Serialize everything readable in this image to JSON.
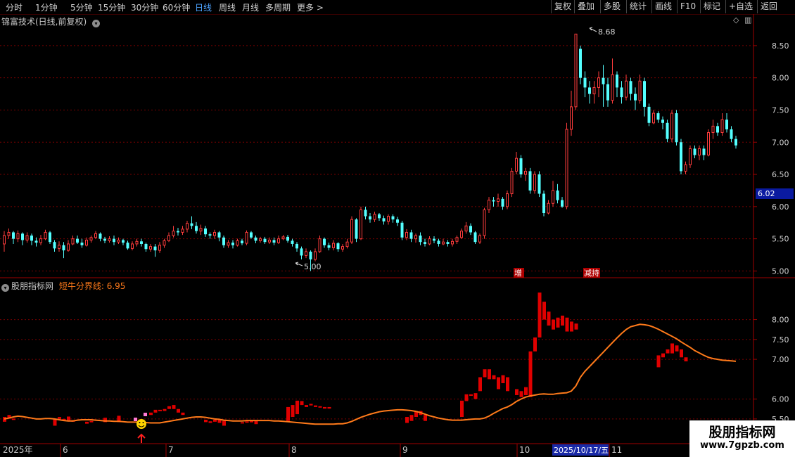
{
  "toolbar": {
    "periods": [
      "分时",
      "1分钟",
      "5分钟",
      "15分钟",
      "30分钟",
      "60分钟",
      "日线",
      "周线",
      "月线",
      "多周期",
      "更多 >"
    ],
    "active_period": "日线",
    "tools": [
      "复权",
      "叠加",
      "多股",
      "统计",
      "画线",
      "F10",
      "标记",
      "+自选",
      "返回"
    ]
  },
  "price_panel": {
    "title": "锦富技术(日线,前复权)",
    "y_ticks": [
      "8.50",
      "8.00",
      "7.50",
      "7.00",
      "6.50",
      "6.00",
      "5.50",
      "5.00"
    ],
    "current_price_label": "6.02",
    "high_label": "8.68",
    "low_label": "5.00",
    "event_markers": [
      "增",
      "减持"
    ]
  },
  "indicator_panel": {
    "title": "股朋指标网",
    "line_label": "短牛分界线: 6.95",
    "y_ticks": [
      "8.00",
      "7.50",
      "7.00",
      "6.00",
      "5.50"
    ]
  },
  "time_axis": {
    "labels": [
      "2025年",
      "6",
      "7",
      "8",
      "9",
      "10",
      "11"
    ],
    "cursor_date": "2025/10/17/五"
  },
  "watermark": {
    "line1": "股朋指标网",
    "line2": "www.7gpzb.com"
  },
  "colors": {
    "up": "#ff3c3c",
    "down": "#54ffff",
    "indicator_bar": "#e00000",
    "line": "#ff7a1a",
    "grid": "#7a0000",
    "active_period": "#4da3ff"
  },
  "chart_data": {
    "type": "candlestick",
    "y_range": [
      4.95,
      8.75
    ],
    "indicator_y_range": [
      5.25,
      8.7
    ],
    "candles": [
      [
        5.42,
        5.55,
        5.62,
        5.3
      ],
      [
        5.55,
        5.6,
        5.66,
        5.5
      ],
      [
        5.6,
        5.5,
        5.62,
        5.42
      ],
      [
        5.5,
        5.58,
        5.63,
        5.45
      ],
      [
        5.58,
        5.48,
        5.6,
        5.4
      ],
      [
        5.48,
        5.55,
        5.6,
        5.44
      ],
      [
        5.55,
        5.47,
        5.58,
        5.4
      ],
      [
        5.47,
        5.44,
        5.52,
        5.38
      ],
      [
        5.44,
        5.5,
        5.56,
        5.4
      ],
      [
        5.5,
        5.6,
        5.64,
        5.48
      ],
      [
        5.6,
        5.45,
        5.62,
        5.42
      ],
      [
        5.45,
        5.35,
        5.48,
        5.3
      ],
      [
        5.35,
        5.4,
        5.46,
        5.3
      ],
      [
        5.4,
        5.32,
        5.45,
        5.2
      ],
      [
        5.32,
        5.42,
        5.48,
        5.3
      ],
      [
        5.42,
        5.5,
        5.55,
        5.4
      ],
      [
        5.5,
        5.44,
        5.55,
        5.42
      ],
      [
        5.44,
        5.4,
        5.5,
        5.36
      ],
      [
        5.4,
        5.48,
        5.52,
        5.38
      ],
      [
        5.48,
        5.52,
        5.55,
        5.44
      ],
      [
        5.52,
        5.58,
        5.62,
        5.5
      ],
      [
        5.58,
        5.5,
        5.6,
        5.46
      ],
      [
        5.5,
        5.47,
        5.53,
        5.43
      ],
      [
        5.47,
        5.5,
        5.54,
        5.44
      ],
      [
        5.5,
        5.45,
        5.55,
        5.4
      ],
      [
        5.45,
        5.48,
        5.52,
        5.42
      ],
      [
        5.48,
        5.44,
        5.5,
        5.4
      ],
      [
        5.44,
        5.35,
        5.47,
        5.33
      ],
      [
        5.35,
        5.42,
        5.46,
        5.32
      ],
      [
        5.42,
        5.46,
        5.5,
        5.38
      ],
      [
        5.46,
        5.42,
        5.5,
        5.38
      ],
      [
        5.42,
        5.34,
        5.44,
        5.3
      ],
      [
        5.34,
        5.38,
        5.42,
        5.3
      ],
      [
        5.38,
        5.32,
        5.42,
        5.22
      ],
      [
        5.32,
        5.4,
        5.45,
        5.28
      ],
      [
        5.4,
        5.47,
        5.5,
        5.36
      ],
      [
        5.47,
        5.55,
        5.6,
        5.45
      ],
      [
        5.55,
        5.62,
        5.7,
        5.52
      ],
      [
        5.62,
        5.6,
        5.67,
        5.55
      ],
      [
        5.6,
        5.65,
        5.7,
        5.56
      ],
      [
        5.65,
        5.74,
        5.78,
        5.6
      ],
      [
        5.74,
        5.7,
        5.85,
        5.65
      ],
      [
        5.7,
        5.62,
        5.76,
        5.58
      ],
      [
        5.62,
        5.66,
        5.72,
        5.56
      ],
      [
        5.66,
        5.57,
        5.7,
        5.53
      ],
      [
        5.57,
        5.55,
        5.6,
        5.5
      ],
      [
        5.55,
        5.6,
        5.64,
        5.5
      ],
      [
        5.6,
        5.52,
        5.62,
        5.46
      ],
      [
        5.52,
        5.4,
        5.55,
        5.36
      ],
      [
        5.4,
        5.44,
        5.48,
        5.36
      ],
      [
        5.44,
        5.4,
        5.48,
        5.35
      ],
      [
        5.4,
        5.47,
        5.5,
        5.38
      ],
      [
        5.47,
        5.43,
        5.5,
        5.4
      ],
      [
        5.43,
        5.6,
        5.63,
        5.4
      ],
      [
        5.6,
        5.52,
        5.62,
        5.5
      ],
      [
        5.52,
        5.47,
        5.55,
        5.43
      ],
      [
        5.47,
        5.5,
        5.53,
        5.44
      ],
      [
        5.5,
        5.45,
        5.53,
        5.42
      ],
      [
        5.45,
        5.48,
        5.52,
        5.42
      ],
      [
        5.48,
        5.44,
        5.52,
        5.4
      ],
      [
        5.44,
        5.5,
        5.55,
        5.42
      ],
      [
        5.5,
        5.53,
        5.56,
        5.48
      ],
      [
        5.53,
        5.47,
        5.56,
        5.44
      ],
      [
        5.47,
        5.42,
        5.5,
        5.38
      ],
      [
        5.42,
        5.35,
        5.45,
        5.3
      ],
      [
        5.35,
        5.24,
        5.38,
        5.18
      ],
      [
        5.24,
        5.3,
        5.35,
        5.2
      ],
      [
        5.3,
        5.18,
        5.32,
        5.0
      ],
      [
        5.18,
        5.3,
        5.35,
        5.15
      ],
      [
        5.3,
        5.5,
        5.55,
        5.28
      ],
      [
        5.5,
        5.4,
        5.52,
        5.36
      ],
      [
        5.4,
        5.36,
        5.44,
        5.32
      ],
      [
        5.36,
        5.43,
        5.48,
        5.32
      ],
      [
        5.43,
        5.34,
        5.45,
        5.3
      ],
      [
        5.34,
        5.38,
        5.42,
        5.3
      ],
      [
        5.38,
        5.45,
        5.5,
        5.35
      ],
      [
        5.45,
        5.8,
        5.85,
        5.42
      ],
      [
        5.8,
        5.5,
        5.82,
        5.45
      ],
      [
        5.5,
        5.95,
        6.0,
        5.48
      ],
      [
        5.95,
        5.85,
        6.0,
        5.8
      ],
      [
        5.85,
        5.8,
        5.9,
        5.75
      ],
      [
        5.8,
        5.88,
        5.92,
        5.76
      ],
      [
        5.88,
        5.82,
        5.9,
        5.78
      ],
      [
        5.82,
        5.77,
        5.86,
        5.72
      ],
      [
        5.77,
        5.85,
        5.88,
        5.72
      ],
      [
        5.85,
        5.8,
        5.88,
        5.75
      ],
      [
        5.8,
        5.75,
        5.84,
        5.7
      ],
      [
        5.75,
        5.52,
        5.78,
        5.48
      ],
      [
        5.52,
        5.6,
        5.65,
        5.48
      ],
      [
        5.6,
        5.5,
        5.64,
        5.45
      ],
      [
        5.5,
        5.55,
        5.58,
        5.44
      ],
      [
        5.55,
        5.45,
        5.6,
        5.4
      ],
      [
        5.45,
        5.42,
        5.5,
        5.38
      ],
      [
        5.42,
        5.5,
        5.54,
        5.4
      ],
      [
        5.5,
        5.47,
        5.54,
        5.43
      ],
      [
        5.47,
        5.42,
        5.5,
        5.38
      ],
      [
        5.42,
        5.45,
        5.5,
        5.4
      ],
      [
        5.45,
        5.42,
        5.48,
        5.38
      ],
      [
        5.42,
        5.46,
        5.5,
        5.38
      ],
      [
        5.46,
        5.52,
        5.55,
        5.42
      ],
      [
        5.52,
        5.62,
        5.66,
        5.5
      ],
      [
        5.62,
        5.7,
        5.76,
        5.58
      ],
      [
        5.7,
        5.6,
        5.74,
        5.56
      ],
      [
        5.6,
        5.45,
        5.62,
        5.42
      ],
      [
        5.45,
        5.55,
        5.58,
        5.42
      ],
      [
        5.55,
        5.95,
        5.98,
        5.5
      ],
      [
        5.95,
        6.1,
        6.15,
        5.9
      ],
      [
        6.1,
        6.08,
        6.15,
        6.0
      ],
      [
        6.08,
        6.12,
        6.2,
        6.0
      ],
      [
        6.12,
        6.0,
        6.15,
        5.95
      ],
      [
        6.0,
        6.2,
        6.25,
        5.96
      ],
      [
        6.2,
        6.55,
        6.6,
        6.15
      ],
      [
        6.55,
        6.75,
        6.85,
        6.5
      ],
      [
        6.75,
        6.5,
        6.8,
        6.45
      ],
      [
        6.5,
        6.55,
        6.6,
        6.4
      ],
      [
        6.55,
        6.25,
        6.6,
        6.2
      ],
      [
        6.25,
        6.5,
        6.55,
        6.2
      ],
      [
        6.5,
        6.2,
        6.55,
        6.15
      ],
      [
        6.2,
        5.9,
        6.25,
        5.85
      ],
      [
        5.9,
        6.05,
        6.1,
        5.88
      ],
      [
        6.05,
        6.25,
        6.4,
        6.0
      ],
      [
        6.25,
        6.1,
        6.35,
        6.05
      ],
      [
        6.1,
        6.0,
        6.15,
        5.98
      ],
      [
        6.0,
        7.2,
        7.3,
        5.96
      ],
      [
        7.2,
        7.55,
        7.8,
        7.1
      ],
      [
        7.55,
        8.68,
        8.68,
        7.5
      ],
      [
        8.45,
        8.0,
        8.5,
        7.9
      ],
      [
        8.0,
        7.85,
        8.1,
        7.7
      ],
      [
        7.85,
        7.75,
        7.95,
        7.6
      ],
      [
        7.75,
        7.85,
        7.95,
        7.6
      ],
      [
        7.85,
        8.0,
        8.1,
        7.7
      ],
      [
        8.0,
        7.9,
        8.2,
        7.55
      ],
      [
        7.9,
        7.65,
        8.0,
        7.55
      ],
      [
        7.65,
        8.05,
        8.3,
        7.6
      ],
      [
        8.05,
        7.85,
        8.1,
        7.7
      ],
      [
        7.85,
        7.7,
        7.95,
        7.6
      ],
      [
        7.7,
        7.95,
        8.05,
        7.65
      ],
      [
        7.95,
        7.75,
        8.0,
        7.65
      ],
      [
        7.75,
        7.65,
        7.85,
        7.5
      ],
      [
        7.65,
        7.95,
        8.05,
        7.6
      ],
      [
        7.95,
        7.55,
        8.0,
        7.4
      ],
      [
        7.55,
        7.3,
        7.6,
        7.25
      ],
      [
        7.3,
        7.45,
        7.5,
        7.28
      ],
      [
        7.45,
        7.35,
        7.48,
        7.3
      ],
      [
        7.35,
        7.3,
        7.4,
        7.2
      ],
      [
        7.3,
        7.05,
        7.35,
        7.0
      ],
      [
        7.05,
        7.45,
        7.5,
        7.0
      ],
      [
        7.45,
        7.0,
        7.5,
        6.95
      ],
      [
        7.0,
        6.55,
        7.05,
        6.5
      ],
      [
        6.55,
        6.65,
        6.7,
        6.5
      ],
      [
        6.65,
        6.9,
        6.95,
        6.6
      ],
      [
        6.9,
        6.8,
        6.95,
        6.75
      ],
      [
        6.8,
        6.9,
        6.95,
        6.72
      ],
      [
        6.9,
        6.8,
        6.95,
        6.72
      ],
      [
        6.8,
        7.15,
        7.2,
        6.78
      ],
      [
        7.15,
        7.25,
        7.35,
        7.05
      ],
      [
        7.25,
        7.15,
        7.3,
        7.1
      ],
      [
        7.15,
        7.35,
        7.45,
        7.1
      ],
      [
        7.35,
        7.2,
        7.45,
        7.15
      ],
      [
        7.2,
        7.05,
        7.25,
        7.0
      ],
      [
        7.05,
        6.95,
        7.1,
        6.9
      ]
    ],
    "indicator_line": [
      5.5,
      5.52,
      5.55,
      5.57,
      5.56,
      5.54,
      5.52,
      5.5,
      5.5,
      5.51,
      5.51,
      5.5,
      5.48,
      5.46,
      5.45,
      5.45,
      5.47,
      5.48,
      5.48,
      5.48,
      5.47,
      5.46,
      5.45,
      5.45,
      5.44,
      5.44,
      5.43,
      5.42,
      5.42,
      5.42,
      5.41,
      5.41,
      5.4,
      5.4,
      5.4,
      5.42,
      5.44,
      5.46,
      5.48,
      5.5,
      5.52,
      5.54,
      5.55,
      5.55,
      5.54,
      5.52,
      5.5,
      5.49,
      5.47,
      5.46,
      5.45,
      5.45,
      5.45,
      5.46,
      5.46,
      5.46,
      5.46,
      5.46,
      5.46,
      5.45,
      5.45,
      5.44,
      5.43,
      5.42,
      5.41,
      5.4,
      5.39,
      5.38,
      5.37,
      5.37,
      5.37,
      5.37,
      5.37,
      5.38,
      5.38,
      5.4,
      5.44,
      5.49,
      5.54,
      5.58,
      5.62,
      5.65,
      5.68,
      5.7,
      5.71,
      5.72,
      5.73,
      5.73,
      5.72,
      5.71,
      5.69,
      5.66,
      5.62,
      5.58,
      5.55,
      5.52,
      5.5,
      5.48,
      5.47,
      5.47,
      5.47,
      5.48,
      5.49,
      5.5,
      5.5,
      5.52,
      5.57,
      5.64,
      5.7,
      5.76,
      5.8,
      5.86,
      5.94,
      6.0,
      6.05,
      6.08,
      6.1,
      6.12,
      6.13,
      6.12,
      6.12,
      6.14,
      6.15,
      6.16,
      6.2,
      6.33,
      6.55,
      6.7,
      6.82,
      6.94,
      7.06,
      7.18,
      7.3,
      7.42,
      7.54,
      7.65,
      7.75,
      7.82,
      7.85,
      7.88,
      7.87,
      7.85,
      7.81,
      7.76,
      7.7,
      7.64,
      7.58,
      7.52,
      7.44,
      7.37,
      7.3,
      7.22,
      7.16,
      7.1,
      7.05,
      7.02,
      7.0,
      6.98,
      6.97,
      6.96,
      6.95
    ],
    "indicator_bars": [
      [
        5.43,
        5.55
      ],
      [
        5.6,
        5.51
      ],
      [
        5.51,
        5.5
      ],
      [
        5.33,
        5.49
      ],
      [
        5.5,
        5.55
      ],
      [
        5.5,
        5.47
      ],
      [
        5.47,
        5.56
      ],
      [
        5.47,
        5.43
      ],
      [
        5.38,
        5.43
      ],
      [
        5.43,
        5.45
      ],
      [
        5.53,
        5.42
      ],
      [
        5.42,
        5.58
      ],
      [
        5.6,
        5.66
      ],
      [
        5.66,
        5.73
      ],
      [
        5.73,
        5.7
      ],
      [
        5.7,
        5.75
      ],
      [
        5.75,
        5.82
      ],
      [
        5.85,
        5.75
      ],
      [
        5.75,
        5.66
      ],
      [
        5.66,
        5.6
      ],
      [
        5.42,
        5.48
      ],
      [
        5.4,
        5.44
      ],
      [
        5.43,
        5.48
      ],
      [
        5.48,
        5.4
      ],
      [
        5.33,
        5.45
      ],
      [
        5.4,
        5.42
      ],
      [
        5.42,
        5.44
      ],
      [
        5.44,
        5.45
      ],
      [
        5.37,
        5.45
      ],
      [
        5.45,
        5.8
      ],
      [
        5.55,
        5.85
      ],
      [
        5.62,
        5.96
      ],
      [
        5.95,
        5.85
      ],
      [
        5.85,
        5.8
      ],
      [
        5.84,
        5.88
      ],
      [
        5.84,
        5.8
      ],
      [
        5.8,
        5.82
      ],
      [
        5.8,
        5.76
      ],
      [
        5.76,
        5.8
      ],
      [
        5.4,
        5.55
      ],
      [
        5.45,
        5.6
      ],
      [
        5.55,
        5.7
      ],
      [
        5.7,
        5.6
      ],
      [
        5.6,
        5.45
      ],
      [
        5.55,
        5.96
      ],
      [
        5.95,
        6.12
      ],
      [
        6.08,
        6.12
      ],
      [
        6.0,
        6.15
      ],
      [
        6.2,
        6.55
      ],
      [
        6.55,
        6.75
      ],
      [
        6.5,
        6.75
      ],
      [
        6.5,
        6.6
      ],
      [
        6.25,
        6.55
      ],
      [
        6.4,
        6.6
      ],
      [
        6.2,
        6.55
      ],
      [
        6.1,
        6.25
      ],
      [
        6.05,
        6.2
      ],
      [
        6.1,
        6.3
      ],
      [
        6.05,
        7.2
      ],
      [
        7.2,
        7.55
      ],
      [
        7.55,
        8.68
      ],
      [
        8.0,
        8.45
      ],
      [
        7.85,
        8.2
      ],
      [
        7.75,
        8.0
      ],
      [
        7.8,
        8.05
      ],
      [
        7.85,
        8.1
      ],
      [
        7.7,
        8.05
      ],
      [
        7.7,
        7.95
      ],
      [
        7.75,
        7.9
      ],
      [
        6.8,
        7.1
      ],
      [
        7.05,
        7.15
      ],
      [
        7.15,
        7.25
      ],
      [
        7.15,
        7.4
      ],
      [
        7.2,
        7.35
      ],
      [
        7.05,
        7.25
      ],
      [
        6.95,
        7.05
      ]
    ],
    "indicator_bar_index": [
      0,
      1,
      2,
      11,
      12,
      13,
      14,
      15,
      18,
      19,
      22,
      25,
      32,
      33,
      34,
      35,
      36,
      37,
      38,
      39,
      44,
      45,
      46,
      47,
      48,
      52,
      53,
      54,
      55,
      62,
      63,
      64,
      65,
      66,
      67,
      68,
      69,
      70,
      71,
      88,
      89,
      90,
      91,
      92,
      100,
      101,
      102,
      103,
      104,
      105,
      106,
      107,
      108,
      109,
      110,
      112,
      113,
      114,
      115,
      116,
      117,
      118,
      119,
      120,
      121,
      122,
      123,
      124,
      125,
      143,
      144,
      145,
      146,
      147,
      148,
      149
    ]
  }
}
